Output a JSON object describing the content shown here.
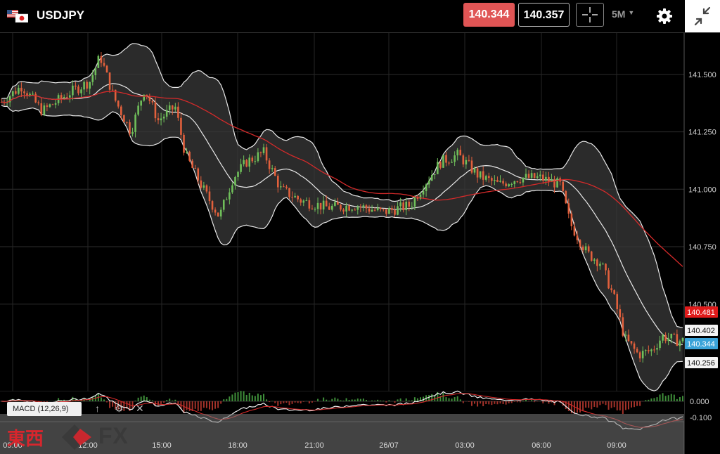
{
  "header": {
    "symbol": "USDJPY",
    "bid": "140.344",
    "ask": "140.357",
    "timeframe": "5M",
    "bid_color": "#e05555"
  },
  "icons": {
    "flags": "us-japan-flag-icon",
    "crosshair": "crosshair-icon",
    "dropdown": "caret-down-icon",
    "settings": "gear-icon",
    "shrink": "shrink-arrows-icon"
  },
  "indicator": {
    "label": "MACD (12,26,9)"
  },
  "logo": {
    "cjk": "東西",
    "fx": "FX"
  },
  "price_tags": [
    {
      "label": "140.481",
      "value": 140.481,
      "style": "red"
    },
    {
      "label": "140.402",
      "value": 140.402,
      "style": "white"
    },
    {
      "label": "140.344",
      "value": 140.344,
      "style": "blue"
    },
    {
      "label": "140.256",
      "value": 140.256,
      "style": "white"
    }
  ],
  "chart_data": {
    "type": "candlestick",
    "symbol": "USDJPY",
    "timeframe": "5M",
    "ylim": [
      140.12,
      141.68
    ],
    "y_ticks": [
      141.5,
      141.25,
      141.0,
      140.75,
      140.5
    ],
    "y_tick_labels": [
      "141.500",
      "141.250",
      "141.000",
      "140.750",
      "140.500"
    ],
    "x_tick_labels": [
      "09:00",
      "12:00",
      "15:00",
      "18:00",
      "21:00",
      "26/07",
      "03:00",
      "06:00",
      "09:00"
    ],
    "overlays": [
      "bollinger-bands",
      "moving-average"
    ],
    "grid": true,
    "price_path": [
      [
        0,
        141.38
      ],
      [
        0.03,
        141.45
      ],
      [
        0.06,
        141.34
      ],
      [
        0.1,
        141.42
      ],
      [
        0.13,
        141.47
      ],
      [
        0.145,
        141.58
      ],
      [
        0.165,
        141.4
      ],
      [
        0.19,
        141.25
      ],
      [
        0.21,
        141.44
      ],
      [
        0.23,
        141.3
      ],
      [
        0.255,
        141.36
      ],
      [
        0.27,
        141.15
      ],
      [
        0.3,
        140.98
      ],
      [
        0.32,
        140.88
      ],
      [
        0.34,
        141.05
      ],
      [
        0.36,
        141.12
      ],
      [
        0.385,
        141.16
      ],
      [
        0.41,
        141.0
      ],
      [
        0.44,
        140.95
      ],
      [
        0.48,
        140.92
      ],
      [
        0.52,
        140.93
      ],
      [
        0.56,
        140.9
      ],
      [
        0.6,
        140.93
      ],
      [
        0.62,
        141.02
      ],
      [
        0.645,
        141.12
      ],
      [
        0.67,
        141.15
      ],
      [
        0.7,
        141.06
      ],
      [
        0.73,
        141.02
      ],
      [
        0.76,
        141.05
      ],
      [
        0.79,
        141.05
      ],
      [
        0.82,
        141.02
      ],
      [
        0.835,
        140.85
      ],
      [
        0.86,
        140.72
      ],
      [
        0.88,
        140.68
      ],
      [
        0.9,
        140.52
      ],
      [
        0.915,
        140.35
      ],
      [
        0.935,
        140.28
      ],
      [
        0.955,
        140.3
      ],
      [
        0.97,
        140.36
      ],
      [
        0.995,
        140.34
      ]
    ],
    "macd": {
      "label": "MACD (12,26,9)",
      "ticks": [
        0.0,
        -0.1
      ],
      "tick_labels": [
        "0.000",
        "-0.100"
      ]
    }
  }
}
